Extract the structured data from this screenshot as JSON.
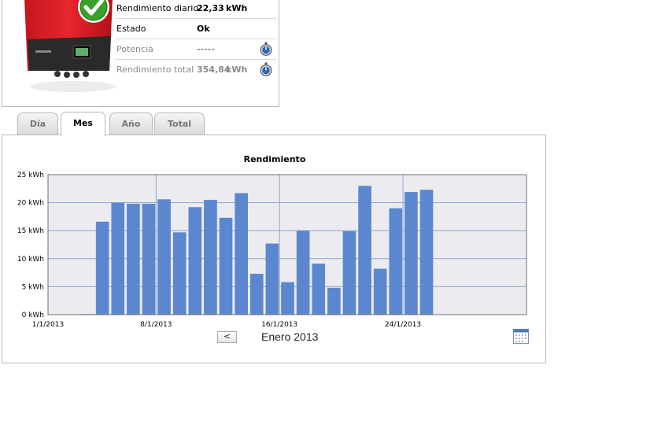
{
  "stats": [
    {
      "label": "Rendimiento diario",
      "value": "22,33",
      "unit": "kWh",
      "muted": false,
      "icon": null
    },
    {
      "label": "Estado",
      "value": "Ok",
      "unit": "",
      "muted": false,
      "icon": null
    },
    {
      "label": "Potencia",
      "value": "-----",
      "unit": "",
      "muted": true,
      "icon": "stopwatch-icon"
    },
    {
      "label": "Rendimiento total",
      "value": "354,84",
      "unit": "kWh",
      "muted": true,
      "icon": "stopwatch-icon"
    }
  ],
  "tabs": [
    {
      "label": "Día",
      "active": false
    },
    {
      "label": "Mes",
      "active": true
    },
    {
      "label": "Año",
      "active": false
    },
    {
      "label": "Total",
      "active": false
    }
  ],
  "nav": {
    "prev_symbol": "<",
    "month_label": "Enero 2013"
  },
  "colors": {
    "bar": "#5b87cf",
    "plot_bg": "#ececf0",
    "grid": "#8ea6cd",
    "inverter_red": "#e0232a",
    "check_green": "#3aa12b"
  },
  "chart_data": {
    "type": "bar",
    "title": "Rendimiento",
    "ylim": [
      0,
      25
    ],
    "y_ticks": [
      "0 kWh",
      "5 kWh",
      "10 kWh",
      "15 kWh",
      "20 kWh",
      "25 kWh"
    ],
    "x_ticks": [
      "1/1/2013",
      "8/1/2013",
      "16/1/2013",
      "24/1/2013"
    ],
    "grid": true,
    "days": [
      1,
      2,
      3,
      4,
      5,
      6,
      7,
      8,
      9,
      10,
      11,
      12,
      13,
      14,
      15,
      16,
      17,
      18,
      19,
      20,
      21,
      22,
      23,
      24,
      25,
      26,
      27,
      28,
      29,
      30,
      31
    ],
    "values": [
      0,
      0,
      0.1,
      16.6,
      20,
      19.8,
      19.8,
      20.6,
      14.7,
      19.2,
      20.5,
      17.3,
      21.7,
      7.3,
      12.7,
      5.8,
      15,
      9.1,
      4.8,
      14.9,
      23,
      8.2,
      19,
      21.9,
      22.3,
      0,
      0,
      0,
      0,
      0,
      0
    ]
  }
}
